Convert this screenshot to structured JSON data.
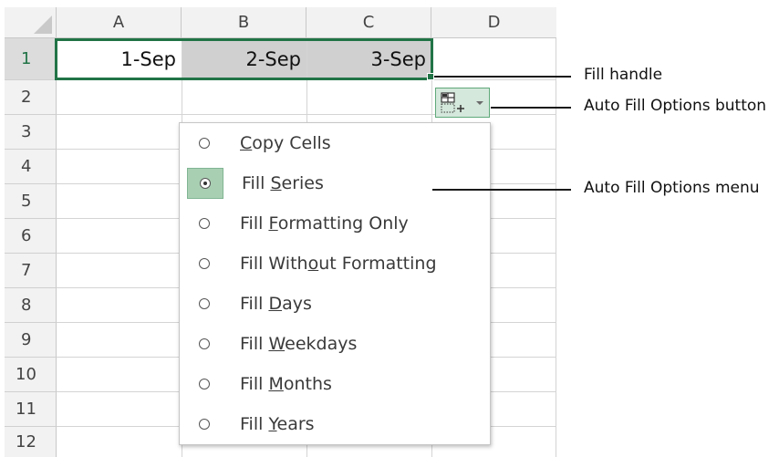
{
  "sheet": {
    "columns": [
      "A",
      "B",
      "C",
      "D"
    ],
    "rows": [
      "1",
      "2",
      "3",
      "4",
      "5",
      "6",
      "7",
      "8",
      "9",
      "10",
      "11",
      "12"
    ],
    "cells": {
      "A1": "1-Sep",
      "B1": "2-Sep",
      "C1": "3-Sep"
    }
  },
  "auto_fill_menu": {
    "items": [
      {
        "pre": "",
        "u": "C",
        "post": "opy Cells",
        "checked": false
      },
      {
        "pre": "Fill ",
        "u": "S",
        "post": "eries",
        "checked": true
      },
      {
        "pre": "Fill ",
        "u": "F",
        "post": "ormatting Only",
        "checked": false
      },
      {
        "pre": "Fill With",
        "u": "o",
        "post": "ut Formatting",
        "checked": false
      },
      {
        "pre": "Fill ",
        "u": "D",
        "post": "ays",
        "checked": false
      },
      {
        "pre": "Fill ",
        "u": "W",
        "post": "eekdays",
        "checked": false
      },
      {
        "pre": "Fill ",
        "u": "M",
        "post": "onths",
        "checked": false
      },
      {
        "pre": "Fill ",
        "u": "Y",
        "post": "ears",
        "checked": false
      }
    ]
  },
  "callouts": {
    "fill_handle": "Fill handle",
    "auto_fill_button": "Auto Fill Options button",
    "auto_fill_menu": "Auto Fill Options menu"
  },
  "icons": {
    "auto_fill_button_icon": "auto-fill-options-icon",
    "dropdown_arrow": "chevron-down-icon",
    "radio": "radio-icon"
  },
  "colors": {
    "accent": "#217346",
    "selected_cell_fill": "#d0d0d0",
    "button_fill": "#d5e8dc"
  }
}
